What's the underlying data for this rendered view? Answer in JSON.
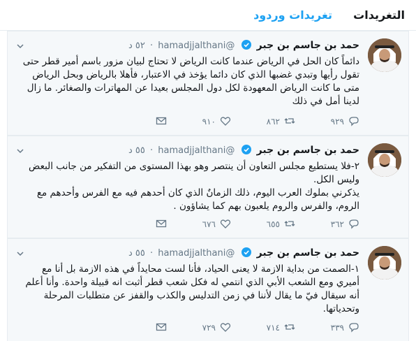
{
  "tabs": {
    "tweets": "التغريدات",
    "replies": "تغريدات وردود"
  },
  "tweets": [
    {
      "name": "حمد بن جاسم بن جبر",
      "handle": "@hamadjjalthani",
      "time": "٥٢ د",
      "text": "دائماً كان الحل في الرياض عندما كانت الرياض لا تحتاج لبيان مزور باسم أمير قطر حتى\nتقول رأيها وتبدي غضبها الذي كان دائما يؤخذ في الاعتبار، فأهلا بالرياض وبحل الرياض\nمتى ما كانت الرياض المعهودة لكل دول المجلس بعيدا عن المهاترات والصغائر. ما زال\nلدينا أمل في ذلك",
      "replies": "٩٢٩",
      "retweets": "٨٦٢",
      "likes": "٩١٠"
    },
    {
      "name": "حمد بن جاسم بن جبر",
      "handle": "@hamadjjalthani",
      "time": "٥٥ د",
      "text": "٢-فلا يستطيع مجلس التعاون أن ينتصر وهو بهذا المستوى من التفكير من جانب البعض\nوليس الكل.\nيذكرني بملوك العرب اليوم، ذلك الزمانٌ الذي كان أحدهم فيه مع الفرس وأحدهم مع\nالروم، والفرس والروم يلعبون بهم كما يشاؤون .",
      "replies": "٣٦٢",
      "retweets": "٦٥٥",
      "likes": "٦٧٦"
    },
    {
      "name": "حمد بن جاسم بن جبر",
      "handle": "@hamadjjalthani",
      "time": "٥٥ د",
      "text": "١-الصمت من بداية الازمة لا يعنى الحياد، فأنا لست محايداً في هذه الازمة بل أنا مع\nأميري ومع الشعب الأبي الذي انتمي له فكل شعب قطر أثبت انه قبيلة واحدة. وأنا أعلم\nأنه سيقال فيّ ما يقال لأننا في زمن التدليس والكذب والقفز عن متطلبات المرحلة\nوتحدياتها.",
      "replies": "٣٣٩",
      "retweets": "٧١٤",
      "likes": "٧٢٩"
    }
  ],
  "icons": {
    "reply": "reply-icon",
    "retweet": "retweet-icon",
    "like": "heart-icon",
    "dm": "envelope-icon",
    "verified": "verified-badge-icon",
    "chevron": "chevron-down-icon"
  },
  "colors": {
    "accent": "#1da1f2",
    "muted": "#657786",
    "tweet_bg": "#f5f8fa",
    "border": "#e6ecf0"
  }
}
